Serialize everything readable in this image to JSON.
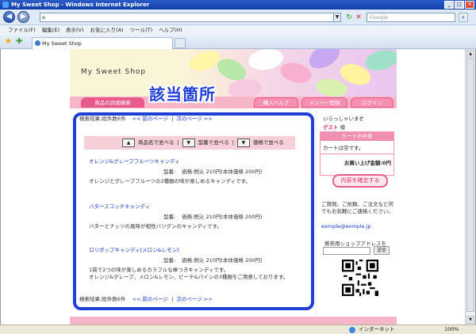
{
  "window": {
    "title": "My Sweet Shop - Windows Internet Explorer"
  },
  "address": {
    "url": "e",
    "search_placeholder": "Google"
  },
  "menu": [
    "ファイル(F)",
    "編集(E)",
    "表示(V)",
    "お気に入り(A)",
    "ツール(T)",
    "ヘルプ(H)"
  ],
  "tab": {
    "label": "My Sweet Shop"
  },
  "shop": {
    "title": "My Sweet Shop"
  },
  "nav": {
    "active": "商品の詳細検索",
    "items": [
      "購入ヘルプ",
      "メンバー登録",
      "ログイン"
    ]
  },
  "overlay": {
    "label": "該当箇所"
  },
  "results": {
    "summary": "検索結果:総件数6件",
    "prev": "<< 前のページ",
    "sep": "|",
    "next": "次のページ >>"
  },
  "sort": {
    "name": "商品名で並べる",
    "model": "型番で並べる",
    "price": "価格で並べる"
  },
  "items": [
    {
      "name": "オレンジ&グレープフルーツキャンディ",
      "model": "型番:",
      "price": "価格:税込 210円(本体価格 200円)",
      "desc": [
        "オレンジとグレープフルーツの2種類の味が楽しめるキャンディです。"
      ]
    },
    {
      "name": "バタースコッチキャンディ",
      "model": "型番:",
      "price": "価格:税込 210円(本体価格 200円)",
      "desc": [
        "バターとナッツの風味が相性バツグンのキャンディです。"
      ]
    },
    {
      "name": "ロリポップキャンディ[メロン&レモン]",
      "model": "型番:",
      "price": "価格:税込 210円(本体価格 200円)",
      "desc": [
        "1袋で2つの味が楽しめるカラフルな棒つきキャンディです。",
        "オレンジ&グレープ、メロン&レモン、ピーチ&パインの3種類をご用意しております。"
      ]
    }
  ],
  "side": {
    "welcome": "いらっしゃいませ",
    "guest": "ゲスト",
    "guest_suffix": "様",
    "cart_title": "カートの中身",
    "cart_empty": "カートは空です。",
    "cart_total": "お買い上げ金額:0円",
    "confirm": "内容を確定する",
    "contact": [
      "ご質問、ご依頼、ご注文など何",
      "でもお気軽にご連絡ください。"
    ],
    "email": "exmple@exmple.jp",
    "mobile_label": "携帯用ショップアドレスをGET",
    "send": "送信"
  },
  "status": {
    "zone": "インターネット",
    "zoom": "100%"
  },
  "colors": {
    "pink": "#f7b6c8",
    "accent": "#e85a8a",
    "frame": "#1f3fd6",
    "link": "#1a3cc8"
  }
}
